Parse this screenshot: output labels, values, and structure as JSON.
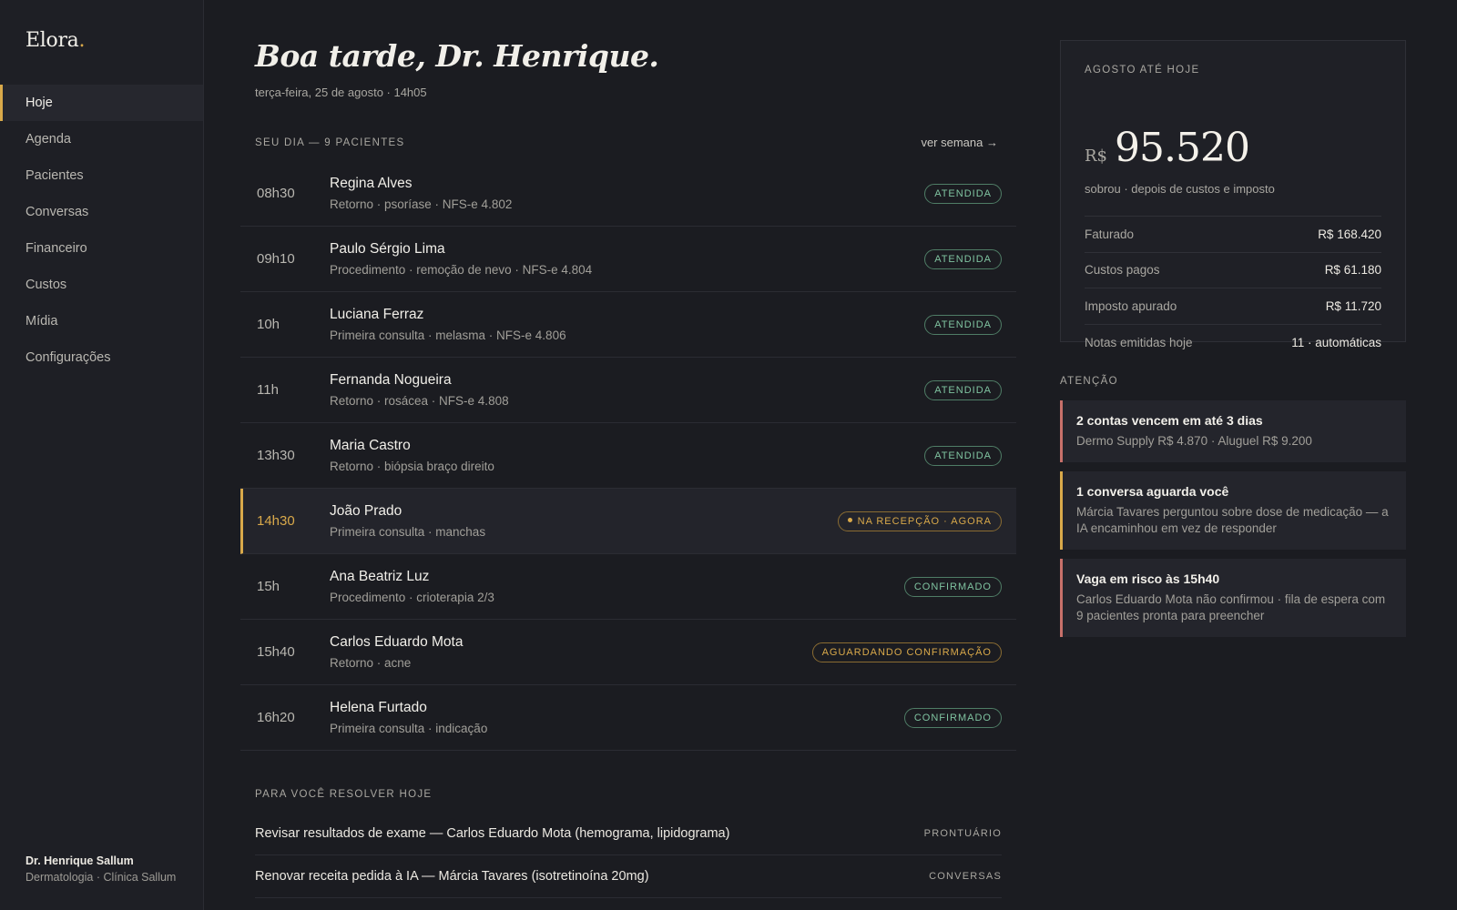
{
  "app": {
    "name": "Elora",
    "name_dot": "."
  },
  "sidebar": {
    "items": [
      {
        "label": "Hoje",
        "active": true
      },
      {
        "label": "Agenda"
      },
      {
        "label": "Pacientes"
      },
      {
        "label": "Conversas"
      },
      {
        "label": "Financeiro"
      },
      {
        "label": "Custos"
      },
      {
        "label": "Mídia"
      },
      {
        "label": "Configurações"
      }
    ],
    "user": {
      "name": "Dr. Henrique Sallum",
      "role": "Dermatologia · Clínica Sallum"
    }
  },
  "main": {
    "greeting": "Boa tarde, Dr. Henrique.",
    "date": "terça-feira, 25 de agosto · 14h05",
    "day_label": "SEU DIA — 9 PACIENTES",
    "see_week": "ver semana →",
    "appointments": [
      {
        "time": "08h30",
        "name": "Regina Alves",
        "detail": "Retorno · psoríase · NFS-e 4.802",
        "status": "ATENDIDA"
      },
      {
        "time": "09h10",
        "name": "Paulo Sérgio Lima",
        "detail": "Procedimento · remoção de nevo · NFS-e 4.804",
        "status": "ATENDIDA"
      },
      {
        "time": "10h",
        "name": "Luciana Ferraz",
        "detail": "Primeira consulta · melasma · NFS-e 4.806",
        "status": "ATENDIDA"
      },
      {
        "time": "11h",
        "name": "Fernanda Nogueira",
        "detail": "Retorno · rosácea · NFS-e 4.808",
        "status": "ATENDIDA"
      },
      {
        "time": "13h30",
        "name": "Maria Castro",
        "detail": "Retorno · biópsia braço direito",
        "status": "ATENDIDA"
      },
      {
        "time": "14h30",
        "name": "João Prado",
        "detail": "Primeira consulta · manchas",
        "status": "NA RECEPÇÃO · AGORA"
      },
      {
        "time": "15h",
        "name": "Ana Beatriz Luz",
        "detail": "Procedimento · crioterapia 2/3",
        "status": "CONFIRMADO"
      },
      {
        "time": "15h40",
        "name": "Carlos Eduardo Mota",
        "detail": "Retorno · acne",
        "status": "AGUARDANDO CONFIRMAÇÃO"
      },
      {
        "time": "16h20",
        "name": "Helena Furtado",
        "detail": "Primeira consulta · indicação",
        "status": "CONFIRMADO"
      }
    ],
    "todo_label": "PARA VOCÊ RESOLVER HOJE",
    "todos": [
      {
        "text": "Revisar resultados de exame — Carlos Eduardo Mota (hemograma, lipidograma)",
        "tag": "PRONTUÁRIO"
      },
      {
        "text": "Renovar receita pedida à IA — Márcia Tavares (isotretinoína 20mg)",
        "tag": "CONVERSAS"
      }
    ]
  },
  "summary": {
    "label": "AGOSTO ATÉ HOJE",
    "currency": "R$",
    "amount": "95.520",
    "subtitle": "sobrou · depois de custos e imposto",
    "rows": [
      {
        "k": "Faturado",
        "v": "R$ 168.420"
      },
      {
        "k": "Custos pagos",
        "v": "R$ 61.180"
      },
      {
        "k": "Imposto apurado",
        "v": "R$ 11.720"
      },
      {
        "k": "Notas emitidas hoje",
        "v": "11 · automáticas"
      }
    ]
  },
  "attention": {
    "label": "ATENÇÃO",
    "alerts": [
      {
        "title": "2 contas vencem em até 3 dias",
        "text": "Dermo Supply R$ 4.870 · Aluguel R$ 9.200"
      },
      {
        "title": "1 conversa aguarda você",
        "text": "Márcia Tavares perguntou sobre dose de medicação — a IA encaminhou em vez de responder"
      },
      {
        "title": "Vaga em risco às 15h40",
        "text": "Carlos Eduardo Mota não confirmou · fila de espera com 9 pacientes pronta para preencher"
      }
    ]
  },
  "colors": {
    "accent": "#d9a94a",
    "success": "#7fc3a0",
    "danger": "#c7706a",
    "background": "#1b1c21"
  }
}
